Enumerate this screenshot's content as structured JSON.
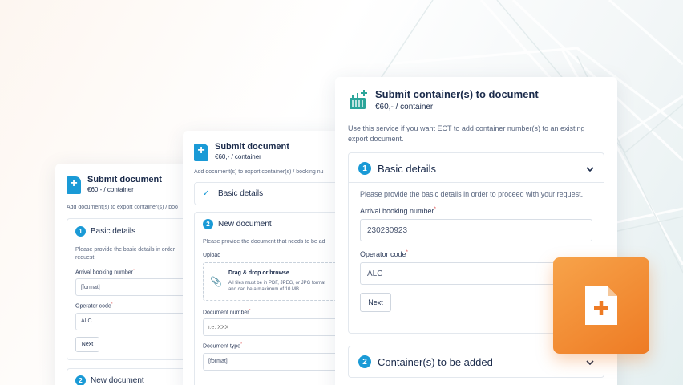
{
  "card1": {
    "title": "Submit document",
    "price": "€60,- / container",
    "description": "Add document(s) to export container(s) / boo",
    "step_number": "1",
    "section_title": "Basic details",
    "section_desc": "Please provide the basic details in order request.",
    "arrival_label": "Arrival booking number",
    "arrival_value": "[format]",
    "operator_label": "Operator code",
    "operator_value": "ALC",
    "next_label": "Next",
    "step2_number": "2",
    "step2_title": "New document"
  },
  "card2": {
    "title": "Submit document",
    "price": "€60,- / container",
    "description": "Add document(s) to export container(s) / booking nu",
    "check_icon": "✓",
    "basic_title": "Basic details",
    "step_number": "2",
    "section_title": "New document",
    "section_desc": "Please provide the document that needs to be ad",
    "upload_label": "Upload",
    "upload_title": "Drag & drop or browse",
    "upload_hint": "All files must be in PDF, JPEG, or JPG format and can be a maximum of 10 MB.",
    "docnum_label": "Document number",
    "docnum_placeholder": "i.e. XXX",
    "doctype_label": "Document type",
    "doctype_value": "[format]"
  },
  "card3": {
    "title": "Submit container(s) to document",
    "price": "€60,- / container",
    "description": "Use this service if you want ECT to add container number(s) to an existing export document.",
    "step_number": "1",
    "section_title": "Basic details",
    "section_desc": "Please provide the basic details in order to proceed with your request.",
    "arrival_label": "Arrival booking number",
    "arrival_value": "230230923",
    "operator_label": "Operator code",
    "operator_value": "ALC",
    "next_label": "Next",
    "step2_number": "2",
    "step2_title": "Container(s) to be added",
    "required_mark": "*"
  },
  "colors": {
    "accent": "#1a9ad6",
    "text": "#1b2b4b",
    "orange_start": "#f7a34a",
    "orange_end": "#ee7b24"
  }
}
